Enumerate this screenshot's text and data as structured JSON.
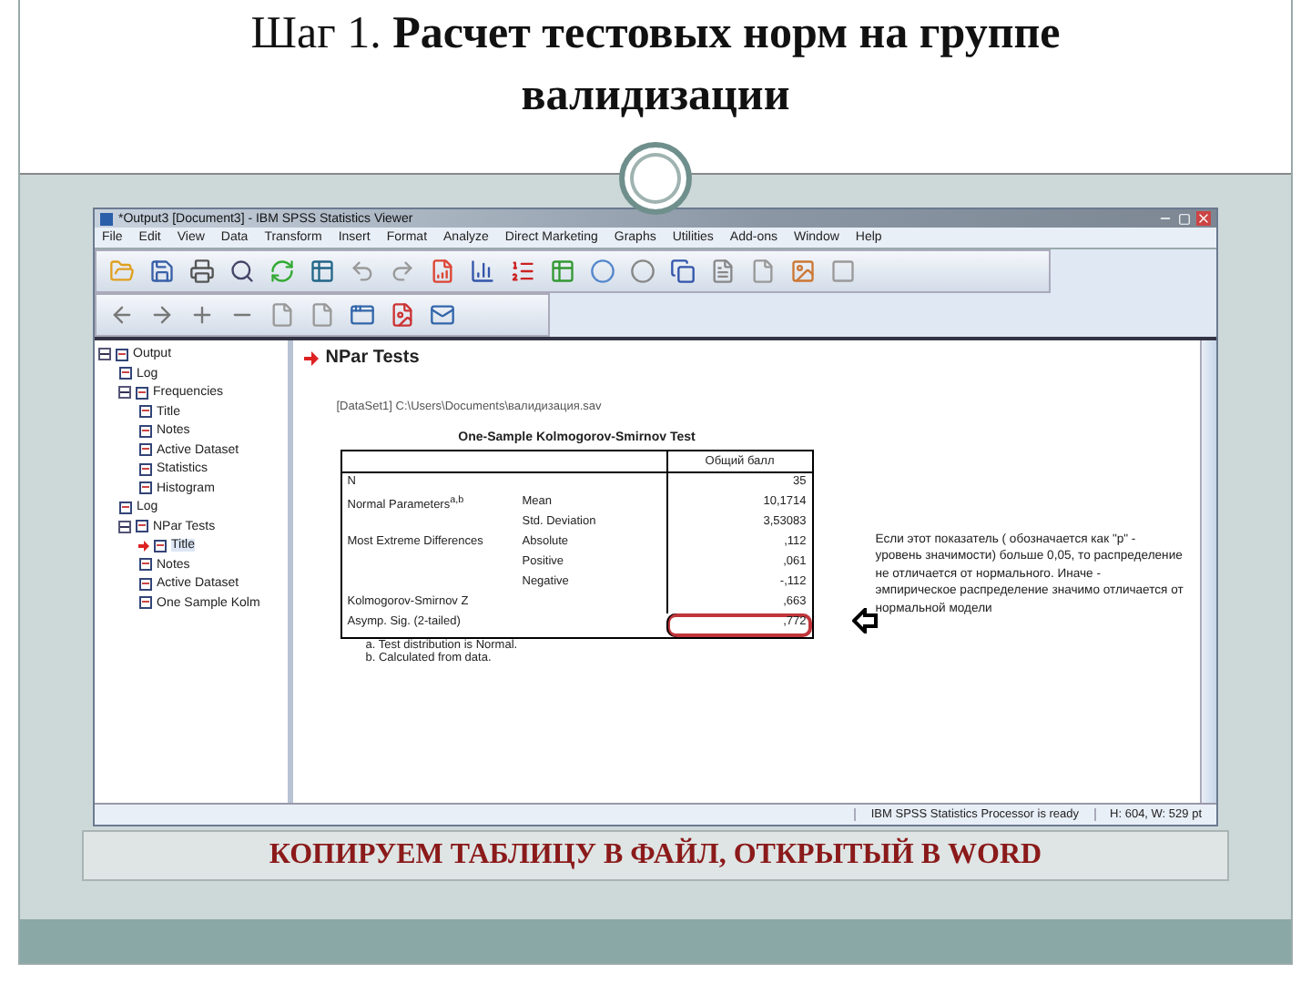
{
  "slide": {
    "title_lines": [
      "Шаг 1. **Расчет тестовых норм на группе**",
      "**валидизации**"
    ],
    "caption": "КОПИРУЕМ ТАБЛИЦУ В ФАЙЛ, ОТКРЫТЫЙ В WORD"
  },
  "window": {
    "title": "*Output3 [Document3] - IBM SPSS Statistics Viewer"
  },
  "menu": [
    "File",
    "Edit",
    "View",
    "Data",
    "Transform",
    "Insert",
    "Format",
    "Analyze",
    "Direct Marketing",
    "Graphs",
    "Utilities",
    "Add-ons",
    "Window",
    "Help"
  ],
  "outline": [
    {
      "label": "Output",
      "expanded": true,
      "selected": false,
      "children": [
        {
          "label": "Log",
          "selected": false
        },
        {
          "label": "Frequencies",
          "expanded": true,
          "selected": false,
          "children": [
            {
              "label": "Title",
              "selected": false
            },
            {
              "label": "Notes",
              "selected": false
            },
            {
              "label": "Active Dataset",
              "selected": false
            },
            {
              "label": "Statistics",
              "selected": false
            },
            {
              "label": "Histogram",
              "selected": false
            }
          ]
        },
        {
          "label": "Log",
          "selected": false
        },
        {
          "label": "NPar Tests",
          "expanded": true,
          "selected": false,
          "children": [
            {
              "label": "Title",
              "selected": true
            },
            {
              "label": "Notes",
              "selected": false
            },
            {
              "label": "Active Dataset",
              "selected": false
            },
            {
              "label": "One Sample Kolm",
              "selected": false
            }
          ]
        }
      ]
    }
  ],
  "content": {
    "heading": "NPar Tests",
    "path": "[DataSet1] C:\\Users\\Documents\\валидизация.sav",
    "table": {
      "title": "One-Sample Kolmogorov-Smirnov Test",
      "column_header": "Общий балл",
      "rows": [
        {
          "group": "N",
          "value": "35",
          "highlighted": false
        },
        {
          "group": "Normal Parameters$^{a,b}$",
          "stat": "Mean",
          "value": "10,1714",
          "highlighted": false
        },
        {
          "stat": "Std. Deviation",
          "value": "3,53083",
          "highlighted": false
        },
        {
          "group": "Most Extreme Differences",
          "stat": "Absolute",
          "value": ",112",
          "highlighted": false
        },
        {
          "stat": "Positive",
          "value": ",061",
          "highlighted": false
        },
        {
          "stat": "Negative",
          "value": "-,112",
          "highlighted": false
        },
        {
          "group": "Kolmogorov-Smirnov Z",
          "value": ",663",
          "highlighted": false
        },
        {
          "group": "Asymp. Sig. (2-tailed)",
          "value": ",772",
          "highlighted": true
        }
      ],
      "footnotes": [
        "a. Test distribution is Normal.",
        "b. Calculated from data."
      ]
    },
    "note": "Если этот показатель ( обозначается как \"p\" - уровень значимости) больше 0,05, то распределение не отличается от нормального. Иначе - эмпирическое распределение значимо отличается от нормальной модели"
  },
  "status_bar": [
    "IBM SPSS Statistics Processor is ready",
    "H: 604, W: 529 pt"
  ]
}
